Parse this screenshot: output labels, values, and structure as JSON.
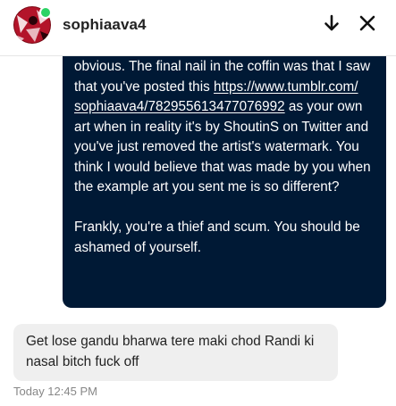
{
  "header": {
    "username": "sophiaava4",
    "online": true,
    "avatar_icon": "avatar-image",
    "minimize_icon": "arrow-down-icon",
    "close_icon": "close-icon"
  },
  "messages": [
    {
      "direction": "outgoing",
      "parts": [
        {
          "text": "obvious. The final nail in the coffin was that I saw that you've posted this "
        },
        {
          "text": "https://www.tumblr.com/sophiaava4/782955613477076992",
          "link": true
        },
        {
          "text": " as your own art when in reality it's by ShoutinS on Twitter and you've just removed the artist's watermark. You think I would believe that was made by you when the example art you sent me is so different?\n\nFrankly, you're a thief and scum. You should be ashamed of yourself."
        }
      ]
    },
    {
      "direction": "incoming",
      "text": "Get lose gandu bharwa tere maki chod Randi ki nasal bitch fuck off"
    }
  ],
  "timestamp": "Today 12:45 PM",
  "colors": {
    "outgoing_bubble": "#001935",
    "incoming_bubble": "#efefef",
    "online": "#2cd365"
  }
}
